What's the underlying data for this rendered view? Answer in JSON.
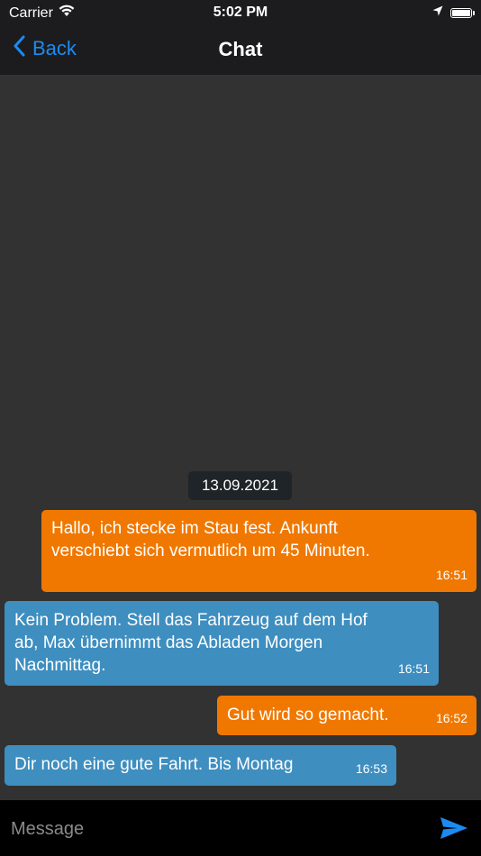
{
  "status_bar": {
    "carrier": "Carrier",
    "time": "5:02 PM",
    "battery_level": 1.0
  },
  "nav": {
    "back_label": "Back",
    "title": "Chat"
  },
  "chat": {
    "date": "13.09.2021",
    "messages": [
      {
        "direction": "outgoing",
        "text": "Hallo, ich stecke im Stau fest. Ankunft\nverschiebt sich vermutlich um 45 Minuten.",
        "time": "16:51"
      },
      {
        "direction": "incoming",
        "text": "Kein Problem. Stell das Fahrzeug auf dem Hof\nab, Max übernimmt das Abladen Morgen\nNachmittag.",
        "time": "16:51"
      },
      {
        "direction": "outgoing",
        "text": "Gut wird so gemacht.",
        "time": "16:52"
      },
      {
        "direction": "incoming",
        "text": "Dir noch eine gute Fahrt. Bis Montag",
        "time": "16:53"
      }
    ]
  },
  "composer": {
    "placeholder": "Message",
    "value": ""
  },
  "colors": {
    "accent": "#1b8bf2",
    "outgoing_bubble": "#f07800",
    "incoming_bubble": "#3e8ec0",
    "chat_background": "#323232",
    "bar_background": "#1c1c1e"
  },
  "icons": {
    "wifi": "wifi-icon",
    "location": "location-arrow-icon",
    "battery": "battery-icon",
    "back": "chevron-left-icon",
    "send": "send-icon"
  }
}
